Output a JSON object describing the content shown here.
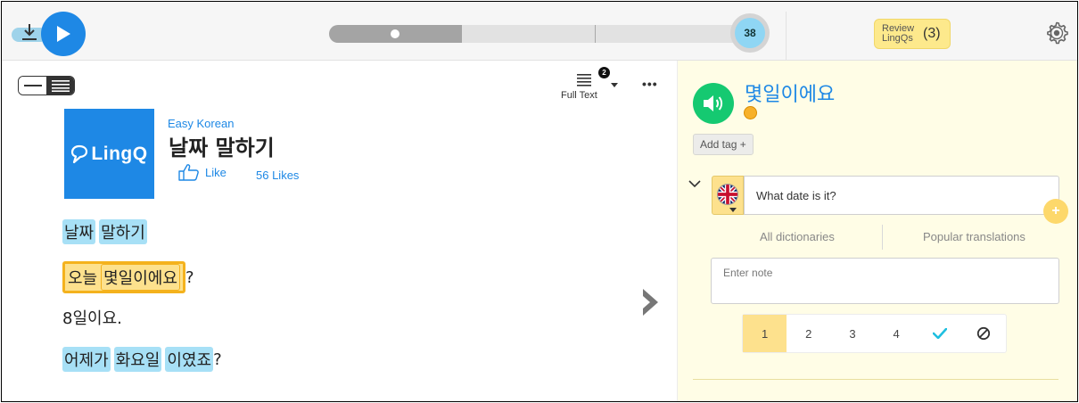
{
  "topbar": {
    "lesson_number": "38",
    "progress": {
      "fill_fraction": 0.316,
      "section_fraction": 0.634,
      "knob_fraction": 0.158
    },
    "review": {
      "label": "Review LingQs",
      "count": "(3)"
    }
  },
  "reader": {
    "full_text_label": "Full Text",
    "full_text_badge": "2",
    "more_label": "•••",
    "logo_text": "LingQ",
    "course": "Easy Korean",
    "title": "날짜 말하기",
    "like_label": "Like",
    "likes_count": "56 Likes",
    "sentences": [
      {
        "words": [
          "날짜",
          "말하기"
        ]
      },
      {
        "words": [
          "오늘",
          "몇일이에요"
        ],
        "punct": "?"
      },
      {
        "text": "8일이요."
      },
      {
        "words": [
          "어제가",
          "화요일",
          "이였죠"
        ],
        "punct": "?"
      }
    ]
  },
  "panel": {
    "term": "몇일이에요",
    "add_tag_label": "Add tag +",
    "meaning": "What date is it?",
    "plus_label": "+",
    "all_dictionaries_label": "All dictionaries",
    "popular_translations_label": "Popular translations",
    "note_placeholder": "Enter note",
    "status_levels": [
      "1",
      "2",
      "3",
      "4"
    ],
    "active_status": "1",
    "known_icon": "checkmark-icon",
    "ignore_icon": "ignore-icon"
  },
  "colors": {
    "brand_blue": "#1e88e5",
    "lingq_yellow": "#fde18d",
    "known_blue": "#a7e0f6",
    "audio_green": "#15c971",
    "panel_bg": "#fffde6"
  }
}
